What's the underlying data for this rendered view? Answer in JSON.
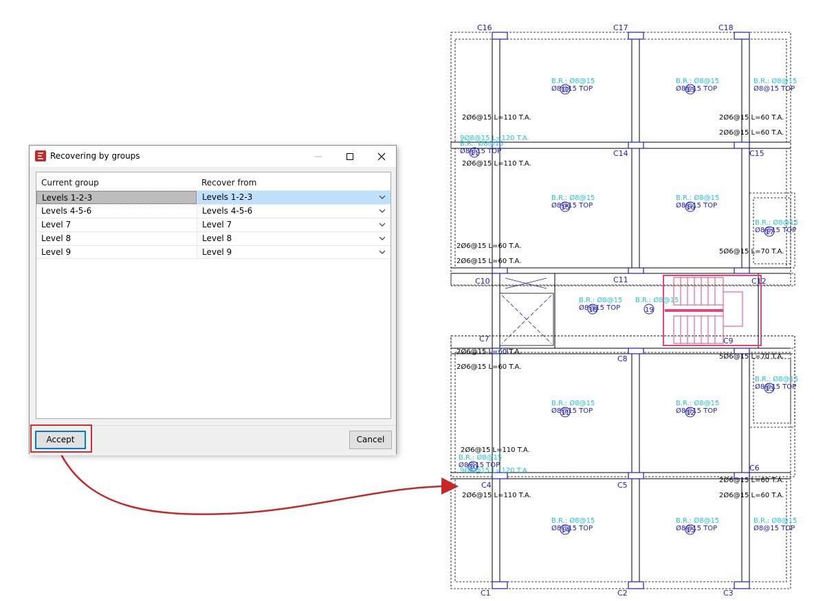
{
  "dialog": {
    "title": "Recovering by groups",
    "columns": [
      "Current group",
      "Recover from"
    ],
    "rows": [
      {
        "current": "Levels 1-2-3",
        "recover": "Levels 1-2-3",
        "selected": true
      },
      {
        "current": "Levels 4-5-6",
        "recover": "Levels 4-5-6",
        "selected": false
      },
      {
        "current": "Level 7",
        "recover": "Level 7",
        "selected": false
      },
      {
        "current": "Level 8",
        "recover": "Level 8",
        "selected": false
      },
      {
        "current": "Level 9",
        "recover": "Level 9",
        "selected": false
      }
    ],
    "accept_label": "Accept",
    "cancel_label": "Cancel"
  },
  "colors": {
    "highlight": "#d32f2f",
    "selection": "#bfe1fb",
    "focus": "#0078d7",
    "plan_blue": "#1a1ad0",
    "plan_cyan": "#1fc8d8",
    "stair": "#e8447a"
  },
  "plan": {
    "columns_labels": [
      "C16",
      "C17",
      "C18",
      "C14",
      "C15",
      "C10",
      "C11",
      "C12",
      "C7",
      "C8",
      "C9",
      "C4",
      "C5",
      "C6",
      "C1",
      "C2",
      "C3"
    ],
    "slab_labels": [
      {
        "br": "B.R.: Ø8@15",
        "top": "Ø8@15 TOP",
        "num": "12"
      },
      {
        "br": "B.R.: Ø8@15",
        "top": "Ø8@15 TOP",
        "num": "13"
      },
      {
        "br": "B.R.: Ø8@15",
        "top": "Ø8@15 TOP",
        "num": "14"
      },
      {
        "br": "B.R.: Ø8@15",
        "top": "Ø8@15 TOP",
        "num": "15"
      },
      {
        "br": "B.R.: Ø8@15",
        "top": "Ø8@15 TOP",
        "num": "16"
      },
      {
        "br": "B.R.: Ø8@15",
        "top": "Ø8@15 TOP",
        "num": "17"
      },
      {
        "br": "B.R.: Ø8@15",
        "top": "Ø8@15 TOP",
        "num": "18"
      },
      {
        "br": "B.R.: Ø8@15",
        "top": "Ø8@15 TOP",
        "num": "19"
      },
      {
        "br": "B.R.: Ø8@15",
        "top": "Ø8@15 TOP",
        "num": "11"
      },
      {
        "br": "B.R.: Ø8@15",
        "top": "Ø8@15 TOP",
        "num": "12"
      },
      {
        "br": "B.R.: Ø8@15",
        "top": "Ø8@15 TOP",
        "num": "13"
      },
      {
        "br": "B.R.: Ø8@15",
        "top": "Ø8@15 TOP",
        "num": "14"
      },
      {
        "br": "B.R.: Ø8@15",
        "top": "Ø8@15 TOP",
        "num": "15"
      },
      {
        "br": "B.R.: Ø8@15",
        "top": "Ø8@15 TOP",
        "num": "16"
      },
      {
        "br": "B.R.: Ø8@15",
        "top": "Ø8@15 TOP",
        "num": "10"
      },
      {
        "br": "B.R.: Ø8@15",
        "top": "Ø8@15 TOP",
        "num": "11"
      }
    ],
    "rebar_labels": [
      "2Ø6@15 L=110 T.A.",
      "2Ø6@15 L=60 T.A.",
      "2Ø6@15 L=60 T.A.",
      "9Ø8@15 L=120 T.A.",
      "2Ø6@15 L=110 T.A.",
      "2Ø6@15 L=60 T.A.",
      "2Ø6@15 L=60 T.A.",
      "5Ø6@15 L=70 T.A.",
      "2Ø6@15 L=60 T.A.",
      "2Ø6@15 L=60 T.A.",
      "5Ø6@15 L=70 T.A.",
      "2Ø6@15 L=110 T.A.",
      "9Ø8@15 L=120 T.A.",
      "2Ø6@15 L=60 T.A.",
      "2Ø6@15 L=110 T.A.",
      "2Ø6@15 L=60 T.A."
    ]
  }
}
